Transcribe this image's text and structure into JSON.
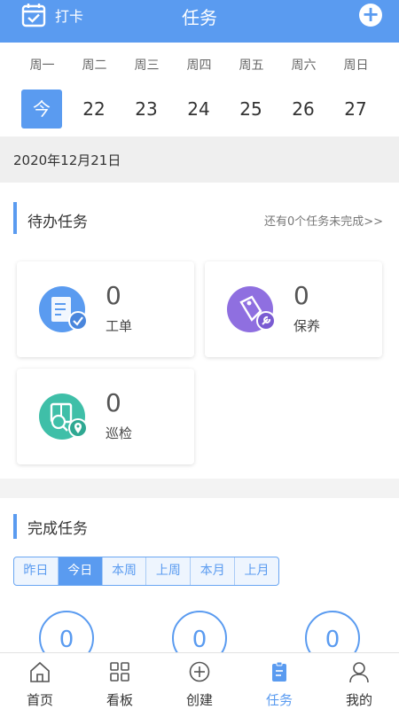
{
  "header": {
    "checkin_label": "打卡",
    "title": "任务"
  },
  "week": {
    "days": [
      {
        "name": "周一",
        "num": "今",
        "active": true
      },
      {
        "name": "周二",
        "num": "22",
        "active": false
      },
      {
        "name": "周三",
        "num": "23",
        "active": false
      },
      {
        "name": "周四",
        "num": "24",
        "active": false
      },
      {
        "name": "周五",
        "num": "25",
        "active": false
      },
      {
        "name": "周六",
        "num": "26",
        "active": false
      },
      {
        "name": "周日",
        "num": "27",
        "active": false
      }
    ]
  },
  "current_date": "2020年12月21日",
  "pending": {
    "title": "待办任务",
    "more_text": "还有0个任务未完成>>",
    "cards": [
      {
        "count": "0",
        "label": "工单",
        "icon": "work-order-icon",
        "color": "#5a9bf0"
      },
      {
        "count": "0",
        "label": "保养",
        "icon": "maintenance-icon",
        "color": "#8f6fe0"
      },
      {
        "count": "0",
        "label": "巡检",
        "icon": "inspection-icon",
        "color": "#3fbfa8"
      }
    ]
  },
  "done": {
    "title": "完成任务",
    "ranges": [
      "昨日",
      "今日",
      "本周",
      "上周",
      "本月",
      "上月"
    ],
    "active_range": "今日",
    "counts": [
      "0",
      "0",
      "0"
    ]
  },
  "tabbar": {
    "tabs": [
      {
        "label": "首页",
        "icon": "home-icon",
        "active": false
      },
      {
        "label": "看板",
        "icon": "dashboard-icon",
        "active": false
      },
      {
        "label": "创建",
        "icon": "create-icon",
        "active": false
      },
      {
        "label": "任务",
        "icon": "task-icon",
        "active": true
      },
      {
        "label": "我的",
        "icon": "profile-icon",
        "active": false
      }
    ]
  },
  "colors": {
    "accent": "#5a9bf0",
    "background": "#f3f3f3"
  }
}
